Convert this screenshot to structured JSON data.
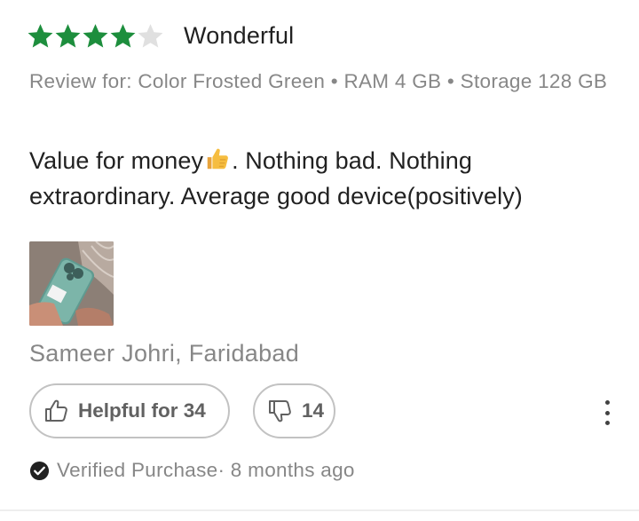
{
  "review": {
    "rating": 4,
    "max_rating": 5,
    "title": "Wonderful",
    "variant": "Review for: Color Frosted Green • RAM 4 GB • Storage 128 GB",
    "text_before_emoji": "Value for money",
    "emoji": "thumbs-up-icon",
    "text_after_emoji": ". Nothing bad. Nothing extraordinary. Average good device(positively)",
    "author": "Sameer Johri, Faridabad",
    "helpful_label": "Helpful for 34",
    "unhelpful_count": "14",
    "verified": "Verified Purchase",
    "time": "· 8 months ago"
  },
  "colors": {
    "star_filled": "#1d8e3d",
    "star_empty": "#e0e0e0",
    "muted_text": "#878787",
    "button_border": "#c2c2c2"
  }
}
